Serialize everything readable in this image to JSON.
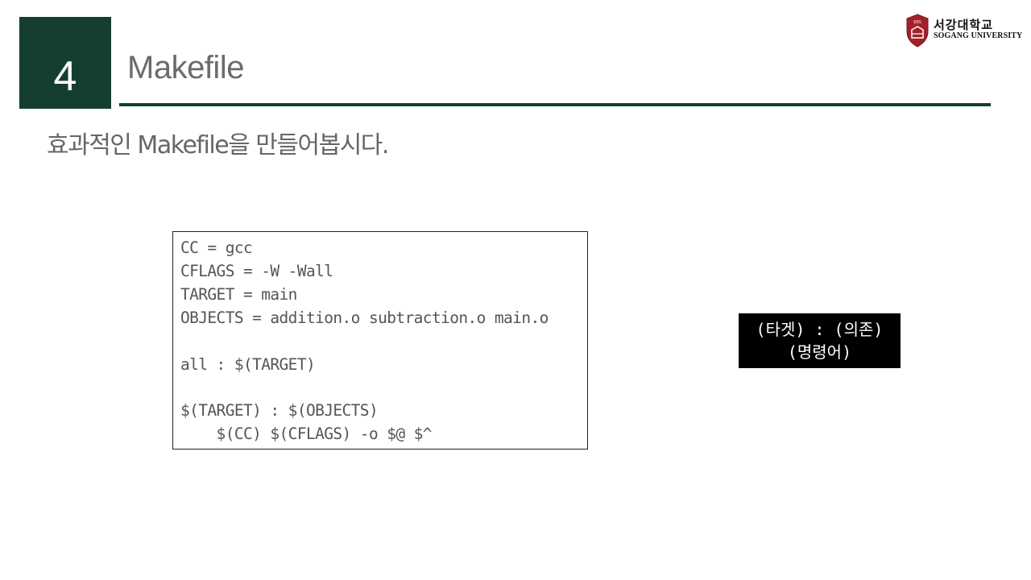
{
  "slide": {
    "number": "4",
    "title": "Makefile",
    "subtitle": "효과적인 Makefile을 만들어봅시다."
  },
  "logo": {
    "kr": "서강대학교",
    "en": "SOGANG UNIVERSITY",
    "shield_label": "IHS"
  },
  "code": {
    "lines": [
      "CC = gcc",
      "CFLAGS = -W -Wall",
      "TARGET = main",
      "OBJECTS = addition.o subtraction.o main.o",
      "",
      "all : $(TARGET)",
      "",
      "$(TARGET) : $(OBJECTS)",
      "    $(CC) $(CFLAGS) -o $@ $^"
    ]
  },
  "note": {
    "line1": "(타겟) : (의존)",
    "line2": "(명령어)"
  },
  "colors": {
    "brand_green": "#143f30",
    "shield_red": "#a3202b",
    "text_gray": "#666666"
  }
}
